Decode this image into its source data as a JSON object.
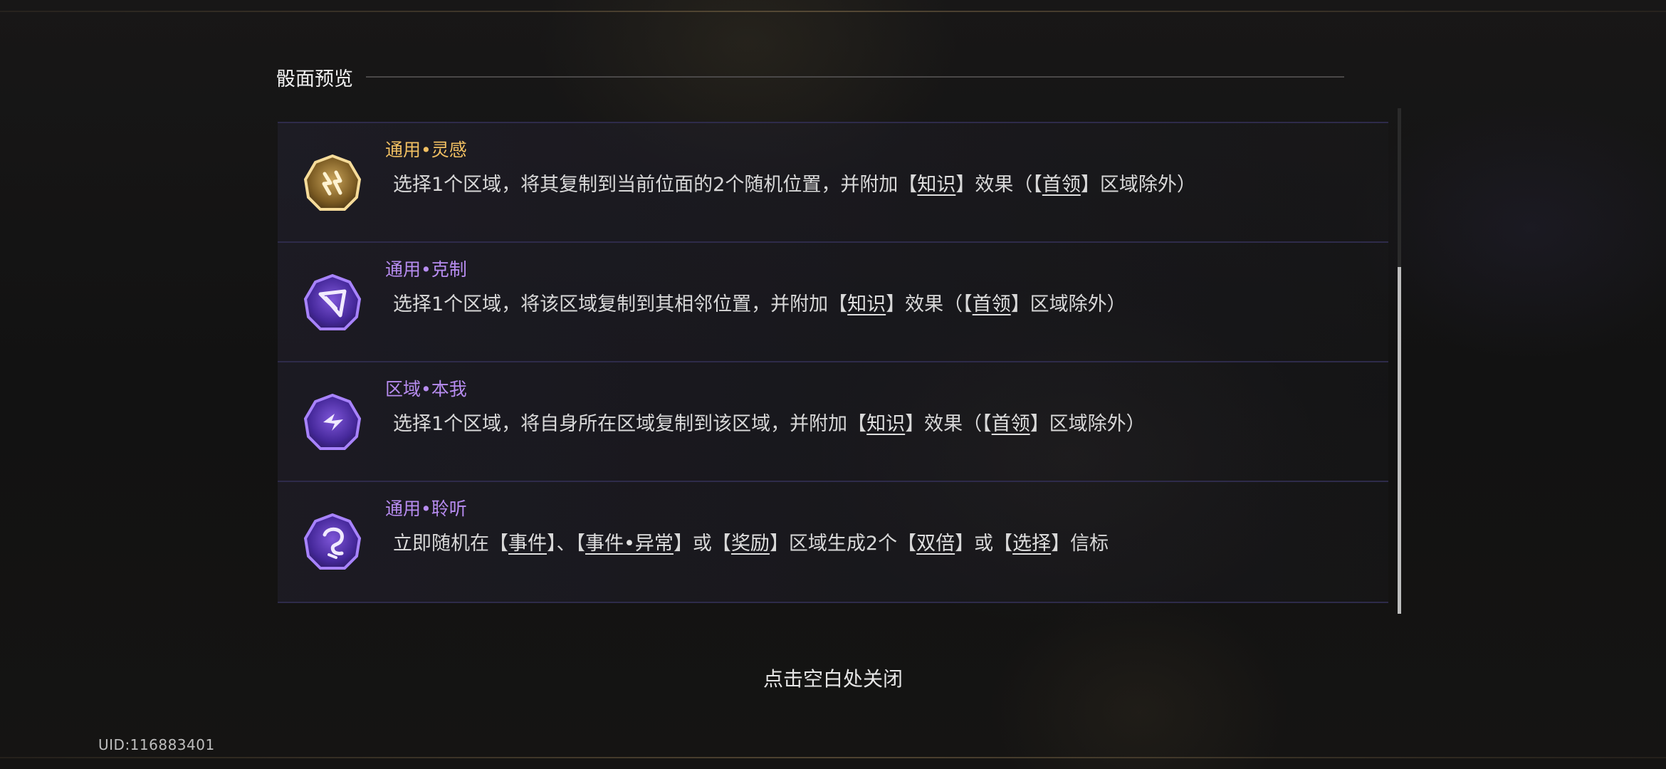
{
  "section": {
    "title": "骰面预览"
  },
  "faces": [
    {
      "title": "通用•灵感",
      "tone": "gold",
      "icon": "spark-sigil-icon",
      "desc": [
        {
          "t": "选择1个区域，将其复制到当前位面的2个随机位置，并附加【"
        },
        {
          "t": "知识",
          "kw": true
        },
        {
          "t": "】效果（【"
        },
        {
          "t": "首领",
          "kw": true
        },
        {
          "t": "】区域除外）"
        }
      ]
    },
    {
      "title": "通用•克制",
      "tone": "purple",
      "icon": "restrain-sigil-icon",
      "desc": [
        {
          "t": "选择1个区域，将该区域复制到其相邻位置，并附加【"
        },
        {
          "t": "知识",
          "kw": true
        },
        {
          "t": "】效果（【"
        },
        {
          "t": "首领",
          "kw": true
        },
        {
          "t": "】区域除外）"
        }
      ]
    },
    {
      "title": "区域•本我",
      "tone": "purple",
      "icon": "self-sigil-icon",
      "desc": [
        {
          "t": "选择1个区域，将自身所在区域复制到该区域，并附加【"
        },
        {
          "t": "知识",
          "kw": true
        },
        {
          "t": "】效果（【"
        },
        {
          "t": "首领",
          "kw": true
        },
        {
          "t": "】区域除外）"
        }
      ]
    },
    {
      "title": "通用•聆听",
      "tone": "purple",
      "icon": "listen-sigil-icon",
      "desc": [
        {
          "t": "立即随机在【"
        },
        {
          "t": "事件",
          "kw": true
        },
        {
          "t": "】、【"
        },
        {
          "t": "事件•异常",
          "kw": true
        },
        {
          "t": "】或【"
        },
        {
          "t": "奖励",
          "kw": true
        },
        {
          "t": "】区域生成2个【"
        },
        {
          "t": "双倍",
          "kw": true
        },
        {
          "t": "】或【"
        },
        {
          "t": "选择",
          "kw": true
        },
        {
          "t": "】信标"
        }
      ]
    }
  ],
  "close_hint": "点击空白处关闭",
  "uid": "UID:116883401",
  "colors": {
    "gold": "#f0bf62",
    "purple": "#b78cf0",
    "row_border": "#2e2b4a",
    "scroll_thumb": "#bdbdbd"
  }
}
